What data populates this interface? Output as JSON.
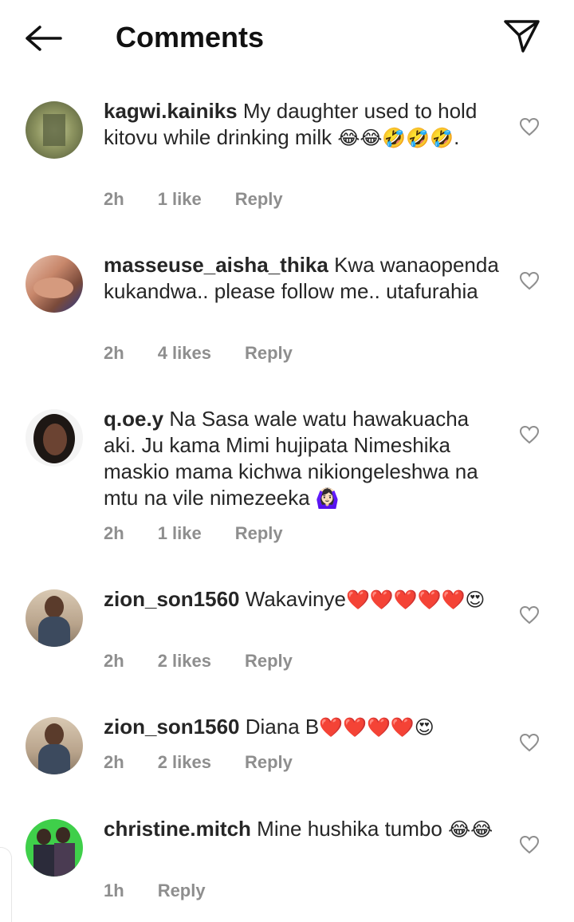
{
  "header": {
    "title": "Comments",
    "back_icon": "arrow-left-icon",
    "send_icon": "paper-plane-icon"
  },
  "comments": [
    {
      "user": "kagwi.kainiks",
      "text": " My daughter used to hold kitovu while drinking milk ",
      "emoji": "😂😂🤣🤣🤣",
      "tail": ".",
      "time": "2h",
      "likes": "1 like",
      "reply": "Reply"
    },
    {
      "user": "masseuse_aisha_thika",
      "text": " Kwa wanaopenda kukandwa.. please follow me.. utafurahia",
      "emoji": "",
      "tail": "",
      "time": "2h",
      "likes": "4 likes",
      "reply": "Reply"
    },
    {
      "user": "q.oe.y",
      "text": " Na Sasa wale watu hawakuacha aki. Ju kama Mimi hujipata Nimeshika maskio mama kichwa nikiongeleshwa na mtu na vile nimezeeka ",
      "emoji": "🙆🏻‍♀️",
      "tail": "",
      "time": "2h",
      "likes": "1 like",
      "reply": "Reply"
    },
    {
      "user": "zion_son1560",
      "text": " Wakavinye",
      "emoji": "❤️❤️❤️❤️❤️😍",
      "tail": "",
      "time": "2h",
      "likes": "2 likes",
      "reply": "Reply"
    },
    {
      "user": "zion_son1560",
      "text": " Diana B",
      "emoji": "❤️❤️❤️❤️😍",
      "tail": "",
      "time": "2h",
      "likes": "2 likes",
      "reply": "Reply"
    },
    {
      "user": "christine.mitch",
      "text": " Mine hushika tumbo ",
      "emoji": "😂😂",
      "tail": "",
      "time": "1h",
      "likes": "",
      "reply": "Reply"
    }
  ],
  "colors": {
    "text": "#262626",
    "meta": "#8e8e8e",
    "heart_outline": "#8e8e8e"
  }
}
